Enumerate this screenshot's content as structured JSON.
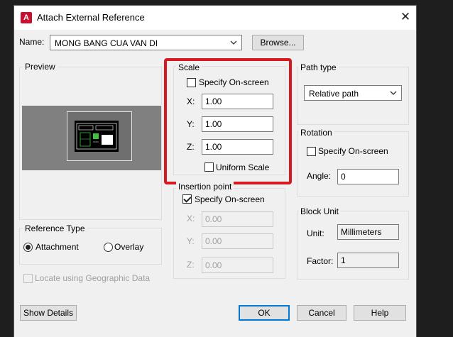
{
  "window": {
    "title": "Attach External Reference",
    "close_glyph": "✕",
    "app_icon_glyph": "A"
  },
  "name_row": {
    "label": "Name:",
    "value": "MONG BANG CUA VAN DI",
    "browse_label": "Browse..."
  },
  "preview": {
    "title": "Preview"
  },
  "scale": {
    "title": "Scale",
    "specify_on_screen": "Specify On-screen",
    "x_label": "X:",
    "x_value": "1.00",
    "y_label": "Y:",
    "y_value": "1.00",
    "z_label": "Z:",
    "z_value": "1.00",
    "uniform_scale": "Uniform Scale"
  },
  "insertion": {
    "title": "Insertion point",
    "specify_on_screen": "Specify On-screen",
    "x_label": "X:",
    "x_value": "0.00",
    "y_label": "Y:",
    "y_value": "0.00",
    "z_label": "Z:",
    "z_value": "0.00"
  },
  "path_type": {
    "title": "Path type",
    "value": "Relative path"
  },
  "rotation": {
    "title": "Rotation",
    "specify_on_screen": "Specify On-screen",
    "angle_label": "Angle:",
    "angle_value": "0"
  },
  "block_unit": {
    "title": "Block Unit",
    "unit_label": "Unit:",
    "unit_value": "Millimeters",
    "factor_label": "Factor:",
    "factor_value": "1"
  },
  "reference_type": {
    "title": "Reference Type",
    "attachment": "Attachment",
    "overlay": "Overlay"
  },
  "geo": {
    "label": "Locate using Geographic Data"
  },
  "buttons": {
    "show_details": "Show Details",
    "ok": "OK",
    "cancel": "Cancel",
    "help": "Help"
  },
  "colors": {
    "highlight": "#d71920",
    "accent": "#0078d7",
    "app_red": "#c8102e"
  }
}
